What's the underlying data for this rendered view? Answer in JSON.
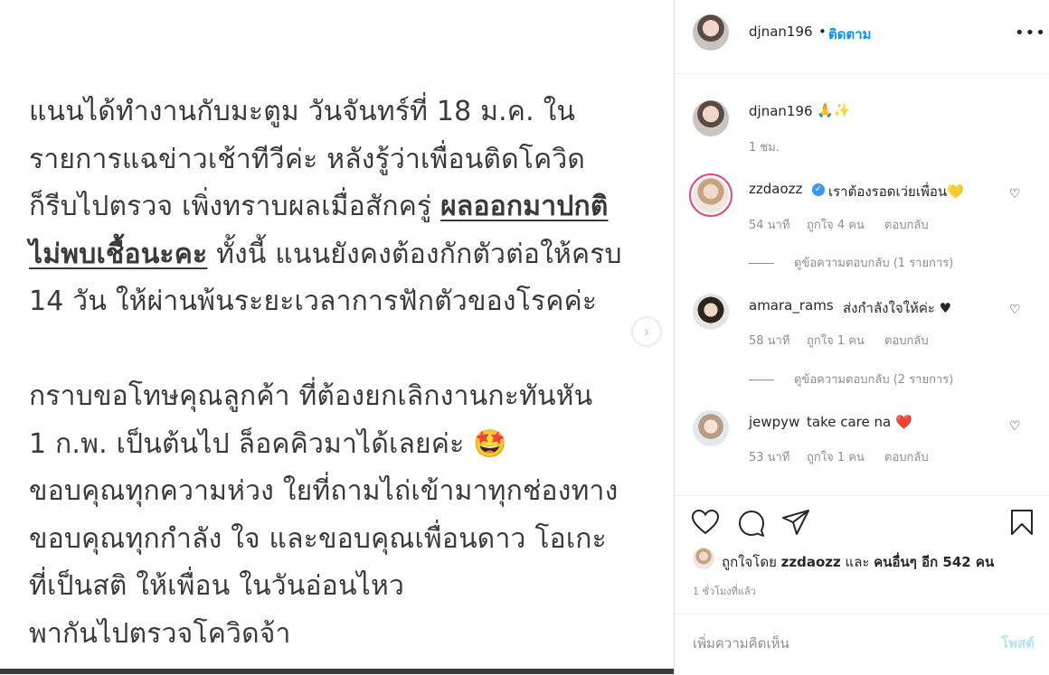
{
  "post": {
    "lines": [
      {
        "a": "แนนได้ทำงานกับมะตูม วันจันทร์ที่ 18 ม.ค. ใน",
        "u": "",
        "b": ""
      },
      {
        "a": "รายการแฉข่าวเช้าทีวีค่ะ หลังรู้ว่าเพื่อนติดโควิด",
        "u": "",
        "b": ""
      },
      {
        "a": "ก็รีบไปตรวจ เพิ่งทราบผลเมื่อสักครู่ ",
        "u": "ผลออกมาปกติ",
        "b": ""
      },
      {
        "a": "",
        "u": "ไม่พบเชื้อนะคะ",
        "b": " ทั้งนี้ แนนยังคงต้องกักตัวต่อให้ครบ"
      },
      {
        "a": "14 วัน  ให้ผ่านพ้นระยะเวลาการฟักตัวของโรคค่ะ",
        "u": "",
        "b": ""
      },
      {
        "a": "",
        "u": "",
        "b": ""
      },
      {
        "a": "กราบขอโทษคุณลูกค้า ที่ต้องยกเลิกงานกะทันหัน",
        "u": "",
        "b": ""
      },
      {
        "a": "1 ก.พ. เป็นต้นไป ล็อคคิวมาได้เลยค่ะ 🤩",
        "u": "",
        "b": ""
      },
      {
        "a": "ขอบคุณทุกความห่วง ใยที่ถามไถ่เข้ามาทุกช่องทาง",
        "u": "",
        "b": ""
      },
      {
        "a": "ขอบคุณทุกกำลัง ใจ และขอบคุณเพื่อนดาว โอเกะ",
        "u": "",
        "b": ""
      },
      {
        "a": "ที่เป็นสติ ให้เพื่อน ในวันอ่อนไหว",
        "u": "",
        "b": ""
      },
      {
        "a": "พากันไปตรวจโควิดจ้า",
        "u": "",
        "b": ""
      }
    ]
  },
  "header": {
    "username": "djnan196",
    "dot": "•",
    "follow": "ติดตาม",
    "more": "•••"
  },
  "caption": {
    "username": "djnan196",
    "text": "🙏✨",
    "time": "1 ชม."
  },
  "comments": [
    {
      "username": "zzdaozz",
      "verified": "✓",
      "text": "เราต้องรอดเว่ยเพื่อน💛",
      "time": "54 นาที",
      "likes": "ถูกใจ 4 คน",
      "reply": "ตอบกลับ",
      "view_replies": "ดูข้อความตอบกลับ (1 รายการ)"
    },
    {
      "username": "amara_rams",
      "text": "ส่งกำลังใจให้ค่ะ ♥",
      "time": "58 นาที",
      "likes": "ถูกใจ 1 คน",
      "reply": "ตอบกลับ",
      "view_replies": "ดูข้อความตอบกลับ (2 รายการ)"
    },
    {
      "username": "jewpyw",
      "text": "take care na ❤️",
      "time": "53 นาที",
      "likes": "ถูกใจ 1 คน",
      "reply": "ตอบกลับ"
    }
  ],
  "icons": {
    "heart": "heart-icon",
    "comment": "comment-icon",
    "share": "share-icon",
    "save": "bookmark-icon"
  },
  "likes": {
    "prefix": "ถูกใจโดย",
    "user": "zzdaozz",
    "and": "และ",
    "others": "คนอื่นๆ อีก 542 คน"
  },
  "time_ago": "1 ชั่วโมงที่แล้ว",
  "comment_box": {
    "placeholder": "เพิ่มความคิดเห็น",
    "post": "โพสต์"
  },
  "colors": {
    "link": "#0095f6",
    "muted": "#8e8e8e",
    "text": "#262626"
  }
}
